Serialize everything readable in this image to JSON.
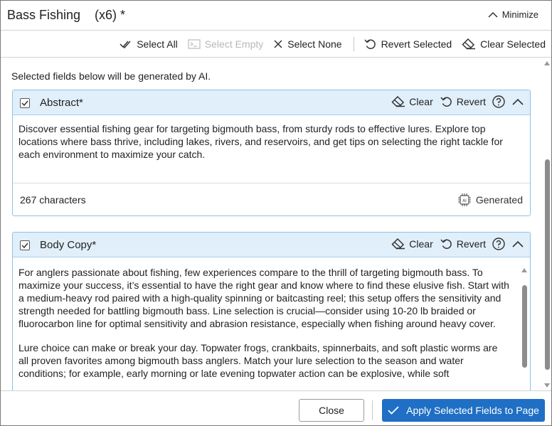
{
  "window": {
    "title": "Bass Fishing    (x6) *",
    "minimize_label": "Minimize"
  },
  "toolbar": {
    "select_all": "Select All",
    "select_empty": "Select Empty",
    "select_none": "Select None",
    "revert_selected": "Revert Selected",
    "clear_selected": "Clear Selected"
  },
  "notice": "Selected fields below will be generated by AI.",
  "abstract": {
    "title": "Abstract*",
    "checked": true,
    "clear_label": "Clear",
    "revert_label": "Revert",
    "text": "Discover essential fishing gear for targeting bigmouth bass, from sturdy rods to effective lures. Explore top locations where bass thrive, including lakes, rivers, and reservoirs, and get tips on selecting the right tackle for each environment to maximize your catch.",
    "char_count": "267 characters",
    "status": "Generated"
  },
  "body_copy": {
    "title": "Body Copy*",
    "checked": true,
    "clear_label": "Clear",
    "revert_label": "Revert",
    "paragraphs": [
      "For anglers passionate about fishing, few experiences compare to the thrill of targeting bigmouth bass. To maximize your success, it’s essential to have the right gear and know where to find these elusive fish. Start with a medium-heavy rod paired with a high-quality spinning or baitcasting reel; this setup offers the sensitivity and strength needed for battling bigmouth bass. Line selection is crucial—consider using 10-20 lb braided or fluorocarbon line for optimal sensitivity and abrasion resistance, especially when fishing around heavy cover.",
      "Lure choice can make or break your day. Topwater frogs, crankbaits, spinnerbaits, and soft plastic worms are all proven favorites among bigmouth bass anglers. Match your lure selection to the season and water conditions; for example, early morning or late evening topwater action can be explosive, while soft"
    ]
  },
  "footer": {
    "close_label": "Close",
    "apply_label": "Apply Selected Fields to Page"
  },
  "colors": {
    "panel_header_bg": "#e1effa",
    "panel_border": "#8fc1e3",
    "primary_button": "#1f6fc5"
  }
}
